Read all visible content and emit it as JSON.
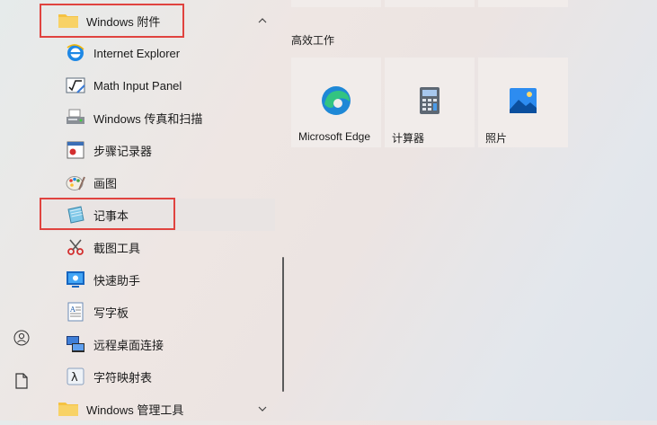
{
  "rail": {
    "user_icon": "user-icon",
    "documents_icon": "document-icon"
  },
  "app_list": {
    "expanded_folder": {
      "label": "Windows 附件",
      "icon": "folder-icon",
      "state": "expanded"
    },
    "items": [
      {
        "label": "Internet Explorer",
        "icon": "internet-explorer-icon"
      },
      {
        "label": "Math Input Panel",
        "icon": "math-input-panel-icon"
      },
      {
        "label": "Windows 传真和扫描",
        "icon": "fax-scan-icon"
      },
      {
        "label": "步骤记录器",
        "icon": "steps-recorder-icon"
      },
      {
        "label": "画图",
        "icon": "paint-icon"
      },
      {
        "label": "记事本",
        "icon": "notepad-icon",
        "selected": true
      },
      {
        "label": "截图工具",
        "icon": "snipping-tool-icon"
      },
      {
        "label": "快速助手",
        "icon": "quick-assist-icon"
      },
      {
        "label": "写字板",
        "icon": "wordpad-icon"
      },
      {
        "label": "远程桌面连接",
        "icon": "remote-desktop-icon"
      },
      {
        "label": "字符映射表",
        "icon": "character-map-icon"
      }
    ],
    "collapsed_folder": {
      "label": "Windows 管理工具",
      "icon": "folder-icon",
      "state": "collapsed"
    }
  },
  "tiles": {
    "group_title": "高效工作",
    "items": [
      {
        "label": "Microsoft Edge",
        "icon": "edge-icon"
      },
      {
        "label": "计算器",
        "icon": "calculator-icon"
      },
      {
        "label": "照片",
        "icon": "photos-icon"
      }
    ]
  },
  "colors": {
    "highlight_border": "#e0433f",
    "folder_yellow": "#f5c242",
    "tile_bg": "#f1ecea"
  }
}
